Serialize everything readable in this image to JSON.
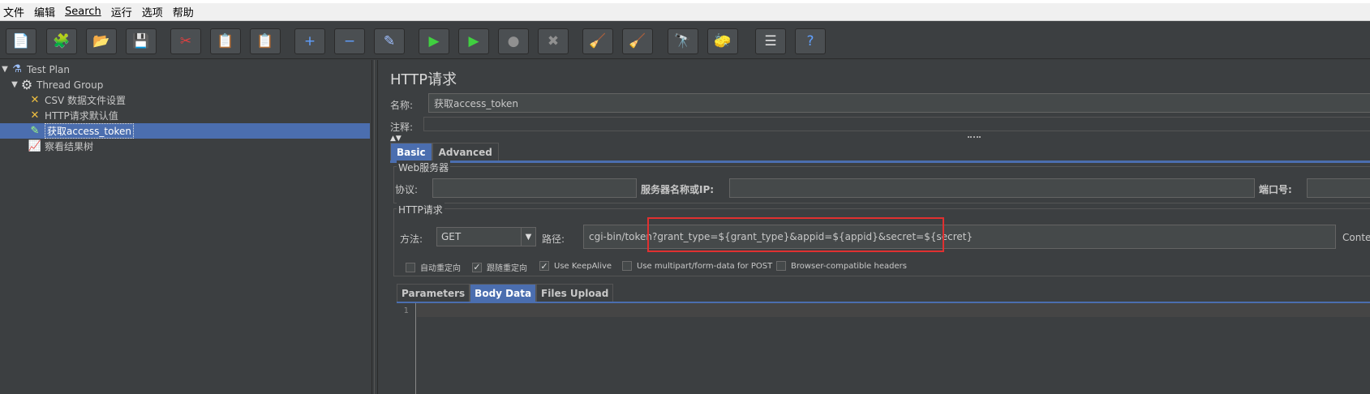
{
  "menubar": {
    "items": [
      "文件",
      "编辑",
      "Search",
      "运行",
      "选项",
      "帮助"
    ]
  },
  "toolbar": {
    "buttons": [
      {
        "name": "new-icon",
        "glyph": "📄"
      },
      {
        "name": "templates-icon",
        "glyph": "🧩"
      },
      {
        "name": "open-icon",
        "glyph": "📂"
      },
      {
        "name": "save-icon",
        "glyph": "💾"
      },
      {
        "name": "cut-icon",
        "glyph": "✂"
      },
      {
        "name": "copy-icon",
        "glyph": "📋"
      },
      {
        "name": "paste-icon",
        "glyph": "📋"
      },
      {
        "name": "expand-icon",
        "glyph": "+"
      },
      {
        "name": "collapse-icon",
        "glyph": "−"
      },
      {
        "name": "toggle-icon",
        "glyph": "✎"
      },
      {
        "name": "start-icon",
        "glyph": "▶"
      },
      {
        "name": "start-no-pauses-icon",
        "glyph": "▶"
      },
      {
        "name": "stop-icon",
        "glyph": "●"
      },
      {
        "name": "shutdown-icon",
        "glyph": "✖"
      },
      {
        "name": "clear-icon",
        "glyph": "🧹"
      },
      {
        "name": "clear-all-icon",
        "glyph": "🧹"
      },
      {
        "name": "search-icon",
        "glyph": "🔭"
      },
      {
        "name": "reset-search-icon",
        "glyph": "🧽"
      },
      {
        "name": "function-helper-icon",
        "glyph": "☰"
      },
      {
        "name": "help-icon",
        "glyph": "?"
      }
    ]
  },
  "tree": {
    "nodes": [
      {
        "label": "Test Plan",
        "icon": "flask-icon",
        "glyph": "⚗",
        "twisty": "▼"
      },
      {
        "label": "Thread Group",
        "icon": "gear-icon",
        "glyph": "⚙",
        "twisty": "▼"
      },
      {
        "label": "CSV 数据文件设置",
        "icon": "wrench-icon",
        "glyph": "✕",
        "twisty": ""
      },
      {
        "label": "HTTP请求默认值",
        "icon": "wrench-icon",
        "glyph": "✕",
        "twisty": ""
      },
      {
        "label": "获取access_token",
        "icon": "pipette-icon",
        "glyph": "✎",
        "twisty": "",
        "selected": true
      },
      {
        "label": "察看结果树",
        "icon": "graph-icon",
        "glyph": "📈",
        "twisty": ""
      }
    ]
  },
  "panel": {
    "title": "HTTP请求",
    "name_label": "名称:",
    "name_value": "获取access_token",
    "comment_label": "注释:",
    "comment_value": "",
    "tabs": [
      "Basic",
      "Advanced"
    ],
    "web_server": {
      "title": "Web服务器",
      "protocol_label": "协议:",
      "protocol_value": "",
      "server_label": "服务器名称或IP:",
      "server_value": "",
      "port_label": "端口号:",
      "port_value": ""
    },
    "http_request": {
      "title": "HTTP请求",
      "method_label": "方法:",
      "method_value": "GET",
      "path_label": "路径:",
      "path_value": "cgi-bin/token?grant_type=${grant_type}&appid=${appid}&secret=${secret}",
      "encoding_label": "Conte"
    },
    "checkboxes": [
      {
        "label": "自动重定向",
        "checked": false
      },
      {
        "label": "跟随重定向",
        "checked": true
      },
      {
        "label": "Use KeepAlive",
        "checked": true
      },
      {
        "label": "Use multipart/form-data for POST",
        "checked": false
      },
      {
        "label": "Browser-compatible headers",
        "checked": false
      }
    ],
    "subtabs": [
      "Parameters",
      "Body Data",
      "Files Upload"
    ],
    "editor": {
      "line_number": "1"
    }
  }
}
